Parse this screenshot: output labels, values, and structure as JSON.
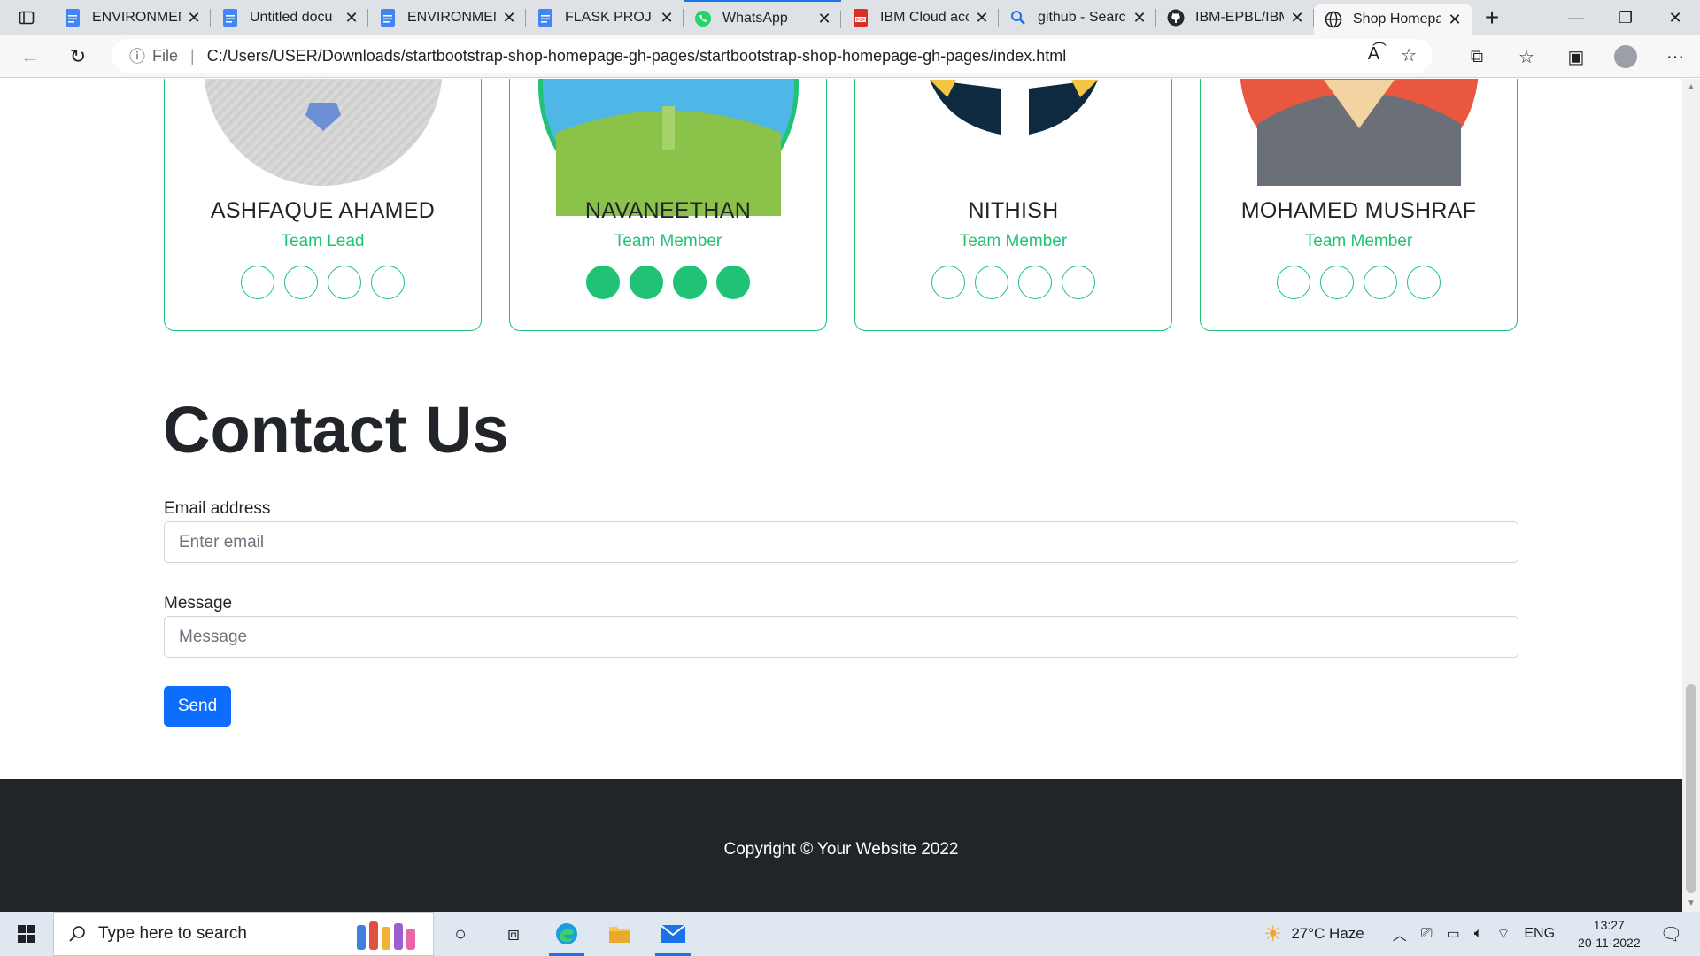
{
  "browser": {
    "tabs": [
      {
        "title": "ENVIRONMEN",
        "icon": "google-docs-icon"
      },
      {
        "title": "Untitled docu",
        "icon": "google-docs-icon"
      },
      {
        "title": "ENVIRONMEN",
        "icon": "google-docs-icon"
      },
      {
        "title": "FLASK PROJEC",
        "icon": "google-docs-icon"
      },
      {
        "title": "WhatsApp",
        "icon": "whatsapp-icon"
      },
      {
        "title": "IBM Cloud acc",
        "icon": "pdf-icon"
      },
      {
        "title": "github - Searc",
        "icon": "search-icon"
      },
      {
        "title": "IBM-EPBL/IBM",
        "icon": "github-icon"
      },
      {
        "title": "Shop Homepa",
        "icon": "globe-icon"
      }
    ],
    "address": {
      "scheme_label": "File",
      "url": "C:/Users/USER/Downloads/startbootstrap-shop-homepage-gh-pages/startbootstrap-shop-homepage-gh-pages/index.html"
    }
  },
  "team": [
    {
      "name": "ASHFAQUE AHAMED",
      "role": "Team Lead"
    },
    {
      "name": "NAVANEETHAN",
      "role": "Team Member"
    },
    {
      "name": "NITHISH",
      "role": "Team Member"
    },
    {
      "name": "MOHAMED MUSHRAF",
      "role": "Team Member"
    }
  ],
  "contact": {
    "title": "Contact Us",
    "email_label": "Email address",
    "email_placeholder": "Enter email",
    "message_label": "Message",
    "message_placeholder": "Message",
    "send_label": "Send"
  },
  "footer": {
    "copyright": "Copyright © Your Website 2022"
  },
  "taskbar": {
    "search_placeholder": "Type here to search",
    "weather": "27°C  Haze",
    "language": "ENG",
    "time": "13:27",
    "date": "20-11-2022"
  },
  "colors": {
    "accent": "#20c375",
    "primary": "#0d6efd",
    "footer_bg": "#212529"
  }
}
